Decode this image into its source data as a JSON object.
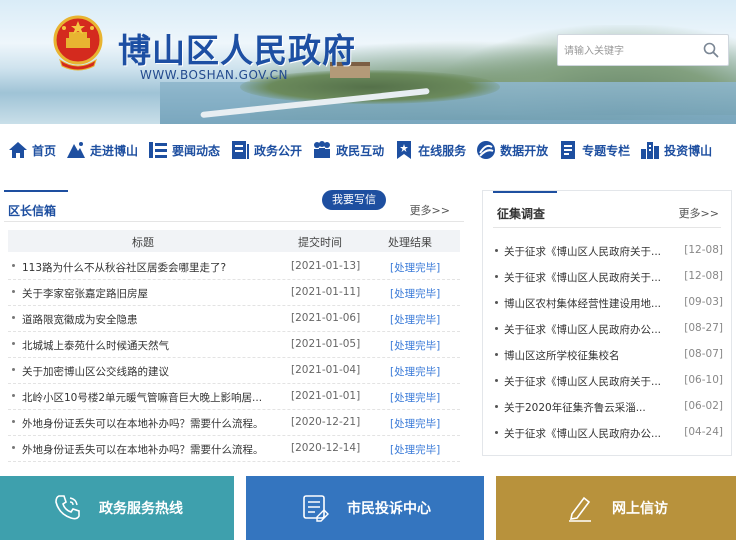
{
  "header": {
    "site_title": "博山区人民政府",
    "site_url": "WWW.BOSHAN.GOV.CN",
    "search_placeholder": "请输入关键字"
  },
  "nav": {
    "items": [
      {
        "label": "首页",
        "icon": "home-icon"
      },
      {
        "label": "走进博山",
        "icon": "mountain-icon"
      },
      {
        "label": "要闻动态",
        "icon": "news-icon"
      },
      {
        "label": "政务公开",
        "icon": "document-icon"
      },
      {
        "label": "政民互动",
        "icon": "people-icon"
      },
      {
        "label": "在线服务",
        "icon": "bookmark-icon"
      },
      {
        "label": "数据开放",
        "icon": "data-icon"
      },
      {
        "label": "专题专栏",
        "icon": "column-icon"
      },
      {
        "label": "投资博山",
        "icon": "building-icon"
      }
    ]
  },
  "mailbox": {
    "title": "区长信箱",
    "write_button": "我要写信",
    "more": "更多>>",
    "columns": {
      "title": "标题",
      "time": "提交时间",
      "status": "处理结果"
    },
    "rows": [
      {
        "title": "113路为什么不从秋谷社区居委会哪里走了?",
        "date": "[2021-01-13]",
        "status": "[处理完毕]"
      },
      {
        "title": "关于李家窑张嘉定路旧房屋",
        "date": "[2021-01-11]",
        "status": "[处理完毕]"
      },
      {
        "title": "道路限宽徽成为安全隐患",
        "date": "[2021-01-06]",
        "status": "[处理完毕]"
      },
      {
        "title": "北城城上泰苑什么时候通天然气",
        "date": "[2021-01-05]",
        "status": "[处理完毕]"
      },
      {
        "title": "关于加密博山区公交线路的建议",
        "date": "[2021-01-04]",
        "status": "[处理完毕]"
      },
      {
        "title": "北岭小区10号楼2单元暖气管嘛音巨大晚上影响居...",
        "date": "[2021-01-01]",
        "status": "[处理完毕]"
      },
      {
        "title": "外地身份证丢失可以在本地补办吗？需要什么流程。",
        "date": "[2020-12-21]",
        "status": "[处理完毕]"
      },
      {
        "title": "外地身份证丢失可以在本地补办吗？需要什么流程。",
        "date": "[2020-12-14]",
        "status": "[处理完毕]"
      }
    ]
  },
  "survey": {
    "title": "征集调查",
    "more": "更多>>",
    "items": [
      {
        "text": "关于征求《博山区人民政府关于...",
        "date": "[12-08]"
      },
      {
        "text": "关于征求《博山区人民政府关于...",
        "date": "[12-08]"
      },
      {
        "text": "博山区农村集体经营性建设用地...",
        "date": "[09-03]"
      },
      {
        "text": "关于征求《博山区人民政府办公...",
        "date": "[08-27]"
      },
      {
        "text": "博山区这所学校征集校名",
        "date": "[08-07]"
      },
      {
        "text": "关于征求《博山区人民政府关于...",
        "date": "[06-10]"
      },
      {
        "text": "关于2020年征集齐鲁云采淄...",
        "date": "[06-02]"
      },
      {
        "text": "关于征求《博山区人民政府办公...",
        "date": "[04-24]"
      }
    ]
  },
  "bottom": {
    "hotline": {
      "label": "政务服务热线",
      "color": "#3ea0ad",
      "icon": "phone-icon"
    },
    "complaint": {
      "label": "市民投诉中心",
      "color": "#3475bf",
      "icon": "feedback-icon"
    },
    "petition": {
      "label": "网上信访",
      "color": "#b8923c",
      "icon": "pen-icon"
    }
  },
  "colors": {
    "primary": "#1e4fa0",
    "status_link": "#3b7bd8"
  }
}
